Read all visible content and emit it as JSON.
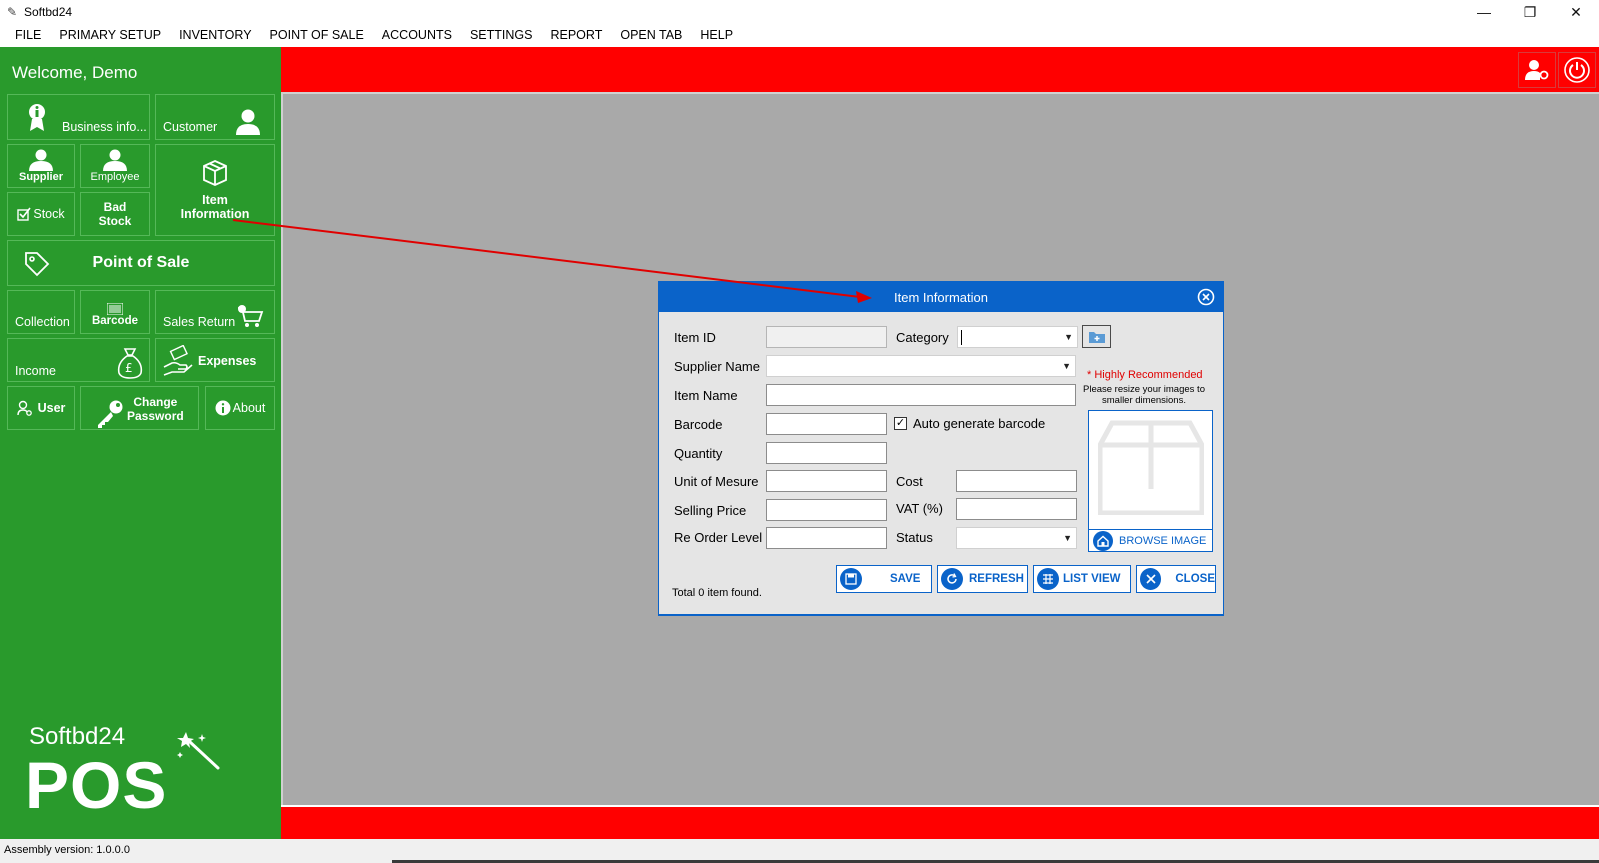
{
  "window": {
    "title": "Softbd24"
  },
  "menu": [
    "FILE",
    "PRIMARY SETUP",
    "INVENTORY",
    "POINT OF SALE",
    "ACCOUNTS",
    "SETTINGS",
    "REPORT",
    "OPEN TAB",
    "HELP"
  ],
  "sidebar": {
    "welcome": "Welcome, Demo",
    "tiles": {
      "business_info": "Business info...",
      "customer": "Customer",
      "supplier": "Supplier",
      "employee": "Employee",
      "item_information_1": "Item",
      "item_information_2": "Information",
      "stock": "Stock",
      "bad_stock_1": "Bad",
      "bad_stock_2": "Stock",
      "point_of_sale": "Point of Sale",
      "collection": "Collection",
      "barcode": "Barcode",
      "sales_return": "Sales Return",
      "income": "Income",
      "expenses": "Expenses",
      "user": "User",
      "change_password_1": "Change",
      "change_password_2": "Password",
      "about": "About"
    },
    "logo_small": "Softbd24",
    "logo_big": "POS"
  },
  "status": {
    "assembly": "Assembly version: 1.0.0.0"
  },
  "dialog": {
    "title": "Item Information",
    "labels": {
      "item_id": "Item ID",
      "category": "Category",
      "supplier_name": "Supplier Name",
      "item_name": "Item Name",
      "barcode": "Barcode",
      "auto_barcode": "Auto generate barcode",
      "quantity": "Quantity",
      "unit": "Unit of Mesure",
      "cost": "Cost",
      "selling_price": "Selling Price",
      "vat": "VAT (%)",
      "reorder": "Re Order Level",
      "status": "Status"
    },
    "values": {
      "item_id": "",
      "category": "",
      "supplier_name": "",
      "item_name": "",
      "barcode": "",
      "quantity": "",
      "unit": "",
      "cost": "",
      "selling_price": "",
      "vat": "",
      "reorder": "",
      "status": ""
    },
    "auto_barcode_checked": true,
    "recommend": "* Highly Recommended",
    "recommend_note": "Please resize your images to smaller dimensions.",
    "browse_image": "BROWSE IMAGE",
    "total": "Total 0 item found.",
    "buttons": {
      "save": "SAVE",
      "refresh": "REFRESH",
      "list_view": "LIST VIEW",
      "close": "CLOSE"
    }
  },
  "colors": {
    "sidebar_green": "#299a2c",
    "bar_red": "#ff0000",
    "dialog_blue": "#0a63c9",
    "main_grey": "#a9a9a9"
  }
}
